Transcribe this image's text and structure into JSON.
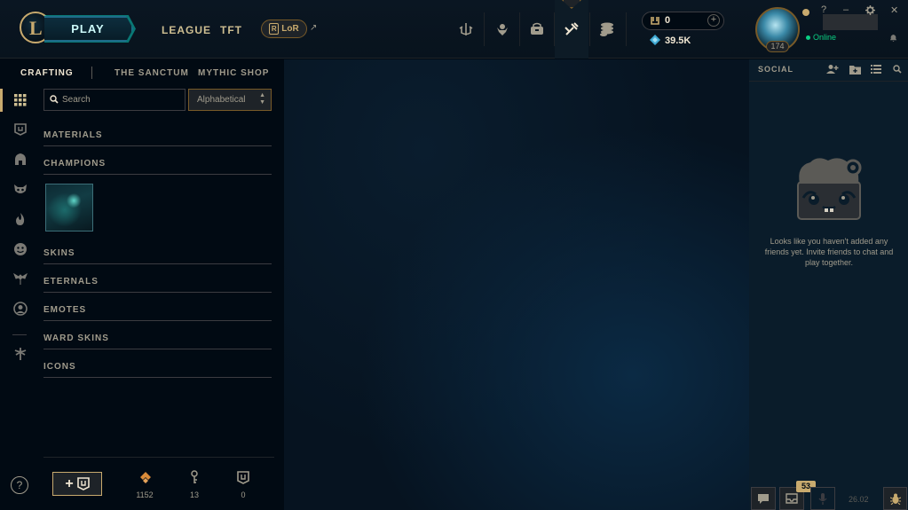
{
  "topbar": {
    "play_label": "PLAY",
    "nav": [
      {
        "label": "LEAGUE"
      },
      {
        "label": "TFT"
      }
    ],
    "lor_label": "LoR",
    "lor_badge": "R",
    "external_arrow": "↗",
    "icons": [
      "home-icon",
      "profile-icon",
      "collection-icon",
      "loot-icon",
      "store-icon"
    ],
    "rp_value": "0",
    "be_value": "39.5K",
    "level": "174",
    "status": "Online",
    "help_glyph": "?",
    "minimize_glyph": "–",
    "close_glyph": "✕"
  },
  "subnav": {
    "tabs": [
      {
        "label": "CRAFTING"
      },
      {
        "label": "THE SANCTUM"
      },
      {
        "label": "MYTHIC SHOP"
      }
    ]
  },
  "rail": {
    "icons": [
      "grid-icon",
      "chest-icon",
      "helmet-icon",
      "mask-icon",
      "flame-icon",
      "emote-face-icon",
      "ward-icon",
      "profile-circle-icon",
      "eternals-icon"
    ],
    "help_glyph": "?"
  },
  "filter": {
    "search_placeholder": "Search",
    "sort_value": "Alphabetical"
  },
  "categories": [
    {
      "label": "MATERIALS"
    },
    {
      "label": "CHAMPIONS"
    },
    {
      "label": "SKINS"
    },
    {
      "label": "ETERNALS"
    },
    {
      "label": "EMOTES"
    },
    {
      "label": "WARD SKINS"
    },
    {
      "label": "ICONS"
    }
  ],
  "loot_bar": {
    "add_label": "+",
    "counts": [
      {
        "icon": "orange-essence-icon",
        "value": "1152"
      },
      {
        "icon": "key-icon",
        "value": "13"
      },
      {
        "icon": "chest-icon",
        "value": "0"
      }
    ]
  },
  "social": {
    "title": "SOCIAL",
    "empty_message": "Looks like you haven't added any friends yet. Invite friends to chat and play together.",
    "notification_count": "53",
    "clock": "26.02"
  },
  "colors": {
    "gold": "#c8aa6e",
    "dark_gold": "#785a28",
    "teal": "#0ac8b9",
    "text": "#a09b8c",
    "online": "#0acf83"
  }
}
